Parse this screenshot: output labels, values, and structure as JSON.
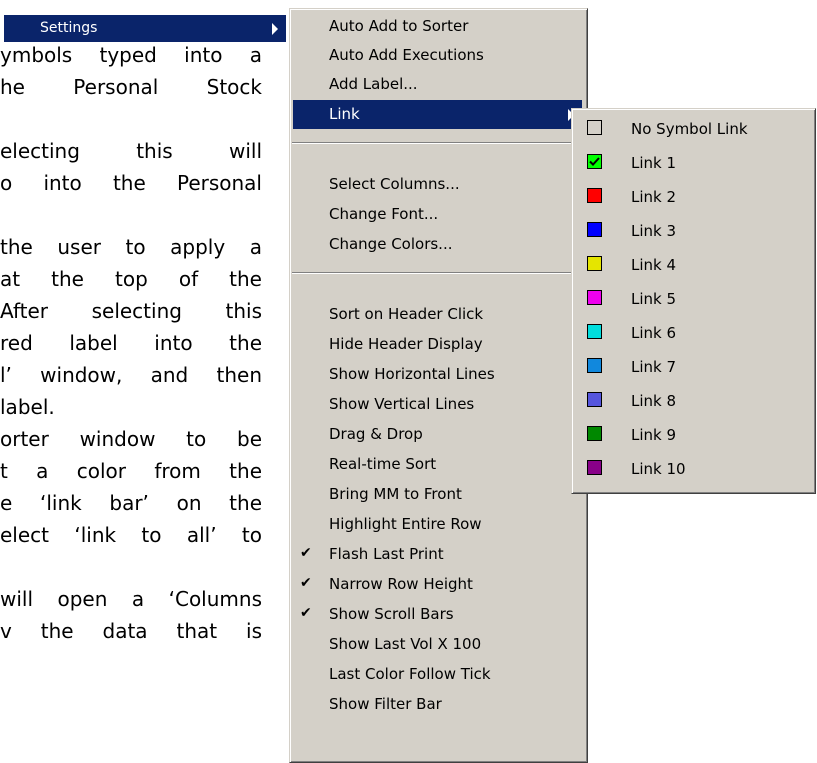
{
  "parent_menu": {
    "item_label": "Settings"
  },
  "doc_text": [
    "ymbols typed into a",
    "he Personal Stock",
    "",
    "electing this will",
    "o into the Personal",
    "",
    "the user to apply a",
    "at the top of the",
    "After selecting this",
    "red label into the",
    "l’ window, and then",
    "label.",
    "orter window to be",
    "t a color from the",
    "e ‘link bar’ on the",
    "elect ‘link to all’ to",
    "",
    "will open a ‘Columns",
    "v the data that is"
  ],
  "settings_menu": {
    "items": [
      {
        "label": "Auto Add to Sorter",
        "checked": false
      },
      {
        "label": "Auto Add Executions",
        "checked": false
      },
      {
        "label": "Add Label...",
        "checked": false
      },
      {
        "label": "Link",
        "checked": false,
        "submenu": true,
        "selected": true
      },
      {
        "label": "Select Columns...",
        "checked": false
      },
      {
        "label": "Change Font...",
        "checked": false
      },
      {
        "label": "Change Colors...",
        "checked": false
      },
      {
        "label": "Sort on Header Click",
        "checked": false
      },
      {
        "label": "Hide Header Display",
        "checked": false
      },
      {
        "label": "Show Horizontal Lines",
        "checked": false
      },
      {
        "label": "Show Vertical Lines",
        "checked": false
      },
      {
        "label": "Drag & Drop",
        "checked": false
      },
      {
        "label": "Real-time Sort",
        "checked": false
      },
      {
        "label": "Bring MM to Front",
        "checked": false
      },
      {
        "label": "Highlight Entire Row",
        "checked": false
      },
      {
        "label": "Flash Last Print",
        "checked": true
      },
      {
        "label": "Narrow Row Height",
        "checked": true
      },
      {
        "label": "Show Scroll Bars",
        "checked": true
      },
      {
        "label": "Show Last Vol X 100",
        "checked": false
      },
      {
        "label": "Last Color Follow Tick",
        "checked": false
      },
      {
        "label": "Show Filter Bar",
        "checked": false
      }
    ]
  },
  "link_menu": {
    "items": [
      {
        "label": "No Symbol Link",
        "color": "#d4d0c8",
        "checked": false
      },
      {
        "label": "Link 1",
        "color": "#00ff00",
        "checked": true
      },
      {
        "label": "Link 2",
        "color": "#ff0000",
        "checked": false
      },
      {
        "label": "Link 3",
        "color": "#0000ff",
        "checked": false
      },
      {
        "label": "Link 4",
        "color": "#e5e500",
        "checked": false
      },
      {
        "label": "Link 5",
        "color": "#ee00ee",
        "checked": false
      },
      {
        "label": "Link 6",
        "color": "#00dddd",
        "checked": false
      },
      {
        "label": "Link 7",
        "color": "#1188dd",
        "checked": false
      },
      {
        "label": "Link 8",
        "color": "#5555dd",
        "checked": false
      },
      {
        "label": "Link 9",
        "color": "#008800",
        "checked": false
      },
      {
        "label": "Link 10",
        "color": "#880088",
        "checked": false
      }
    ]
  }
}
